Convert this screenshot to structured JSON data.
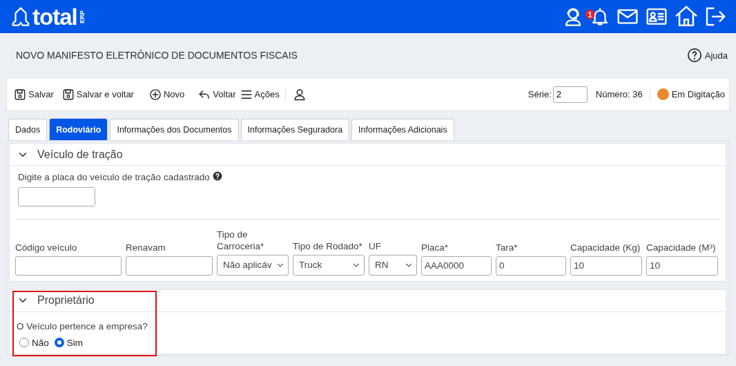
{
  "header": {
    "logo_text": "total",
    "logo_suffix": "ERP",
    "notification_count": "1"
  },
  "page": {
    "title": "NOVO MANIFESTO ELETRÔNICO DE DOCUMENTOS FISCAIS",
    "help": "Ajuda"
  },
  "toolbar": {
    "actions": [
      {
        "kind": "save",
        "label": "Salvar"
      },
      {
        "kind": "save",
        "label": "Salvar e voltar"
      },
      {
        "kind": "new",
        "label": "Novo"
      },
      {
        "kind": "back",
        "label": "Voltar"
      },
      {
        "kind": "menu",
        "label": "Ações"
      }
    ],
    "serie_label": "Série:",
    "serie_value": "2",
    "numero": "Número: 36",
    "status": {
      "label": "Em Digitação",
      "color": "#e8892a"
    }
  },
  "tabs": [
    {
      "label": "Dados",
      "selected": false
    },
    {
      "label": "Rodoviário",
      "selected": true
    },
    {
      "label": "Informações dos Documentos",
      "selected": false
    },
    {
      "label": "Informações Seguradora",
      "selected": false
    },
    {
      "label": "Informações Adicionais",
      "selected": false
    }
  ],
  "sections": [
    {
      "title": "Veículo de tração",
      "expanded": true,
      "highlighted": false,
      "search_label": "Digite a placa do veículo de tração cadastrado",
      "fields": [
        {
          "kind": "text",
          "label": "Código veículo"
        },
        {
          "kind": "text",
          "label": "Renavam"
        },
        {
          "kind": "select",
          "label": "Tipo de Carroceria*",
          "value": "Não aplicáv"
        },
        {
          "kind": "select",
          "label": "Tipo de Rodado*",
          "value": "Truck"
        },
        {
          "kind": "select",
          "label": "UF",
          "value": "RN"
        },
        {
          "kind": "text",
          "label": "Placa*",
          "value": "AAA0000"
        },
        {
          "kind": "text",
          "label": "Tara*",
          "value": "0"
        },
        {
          "kind": "text",
          "label": "Capacidade (Kg)",
          "value": "10"
        },
        {
          "kind": "text",
          "label": "Capacidade (M³)",
          "value": "10"
        }
      ]
    },
    {
      "title": "Proprietário",
      "expanded": true,
      "highlighted": true,
      "question": "O Veículo pertence a empresa?",
      "options": [
        {
          "label": "Não",
          "selected": false
        },
        {
          "label": "Sim",
          "selected": true
        }
      ]
    }
  ]
}
